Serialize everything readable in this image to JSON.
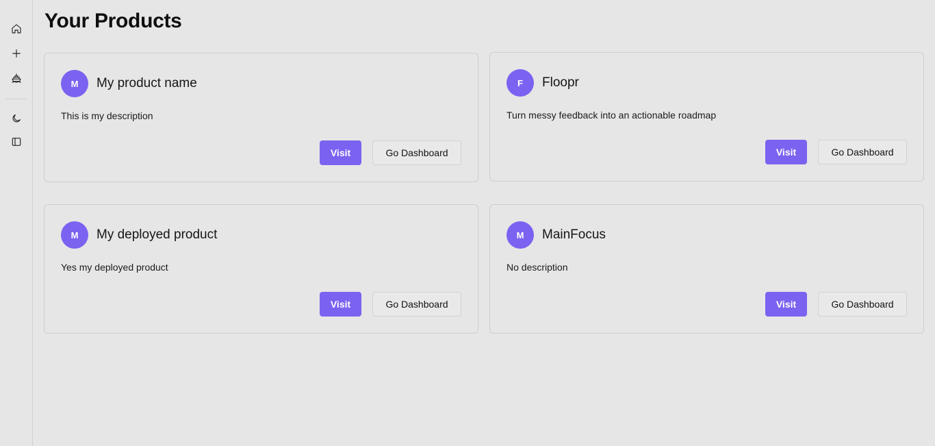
{
  "page": {
    "title": "Your Products"
  },
  "sidebar": {
    "items": [
      {
        "name": "home-icon"
      },
      {
        "name": "plus-icon"
      },
      {
        "name": "ship-icon"
      },
      {
        "name": "moon-icon"
      },
      {
        "name": "sidebar-toggle-icon"
      }
    ]
  },
  "products": [
    {
      "initial": "M",
      "name": "My product name",
      "description": "This is my description",
      "visit_label": "Visit",
      "dashboard_label": "Go Dashboard"
    },
    {
      "initial": "F",
      "name": "Floopr",
      "description": "Turn messy feedback into an actionable roadmap",
      "visit_label": "Visit",
      "dashboard_label": "Go Dashboard"
    },
    {
      "initial": "M",
      "name": "My deployed product",
      "description": "Yes my deployed product",
      "visit_label": "Visit",
      "dashboard_label": "Go Dashboard"
    },
    {
      "initial": "M",
      "name": "MainFocus",
      "description": "No description",
      "visit_label": "Visit",
      "dashboard_label": "Go Dashboard"
    }
  ],
  "colors": {
    "accent": "#7c62f0",
    "background": "#e6e6e6",
    "border": "#cfcfcf"
  }
}
